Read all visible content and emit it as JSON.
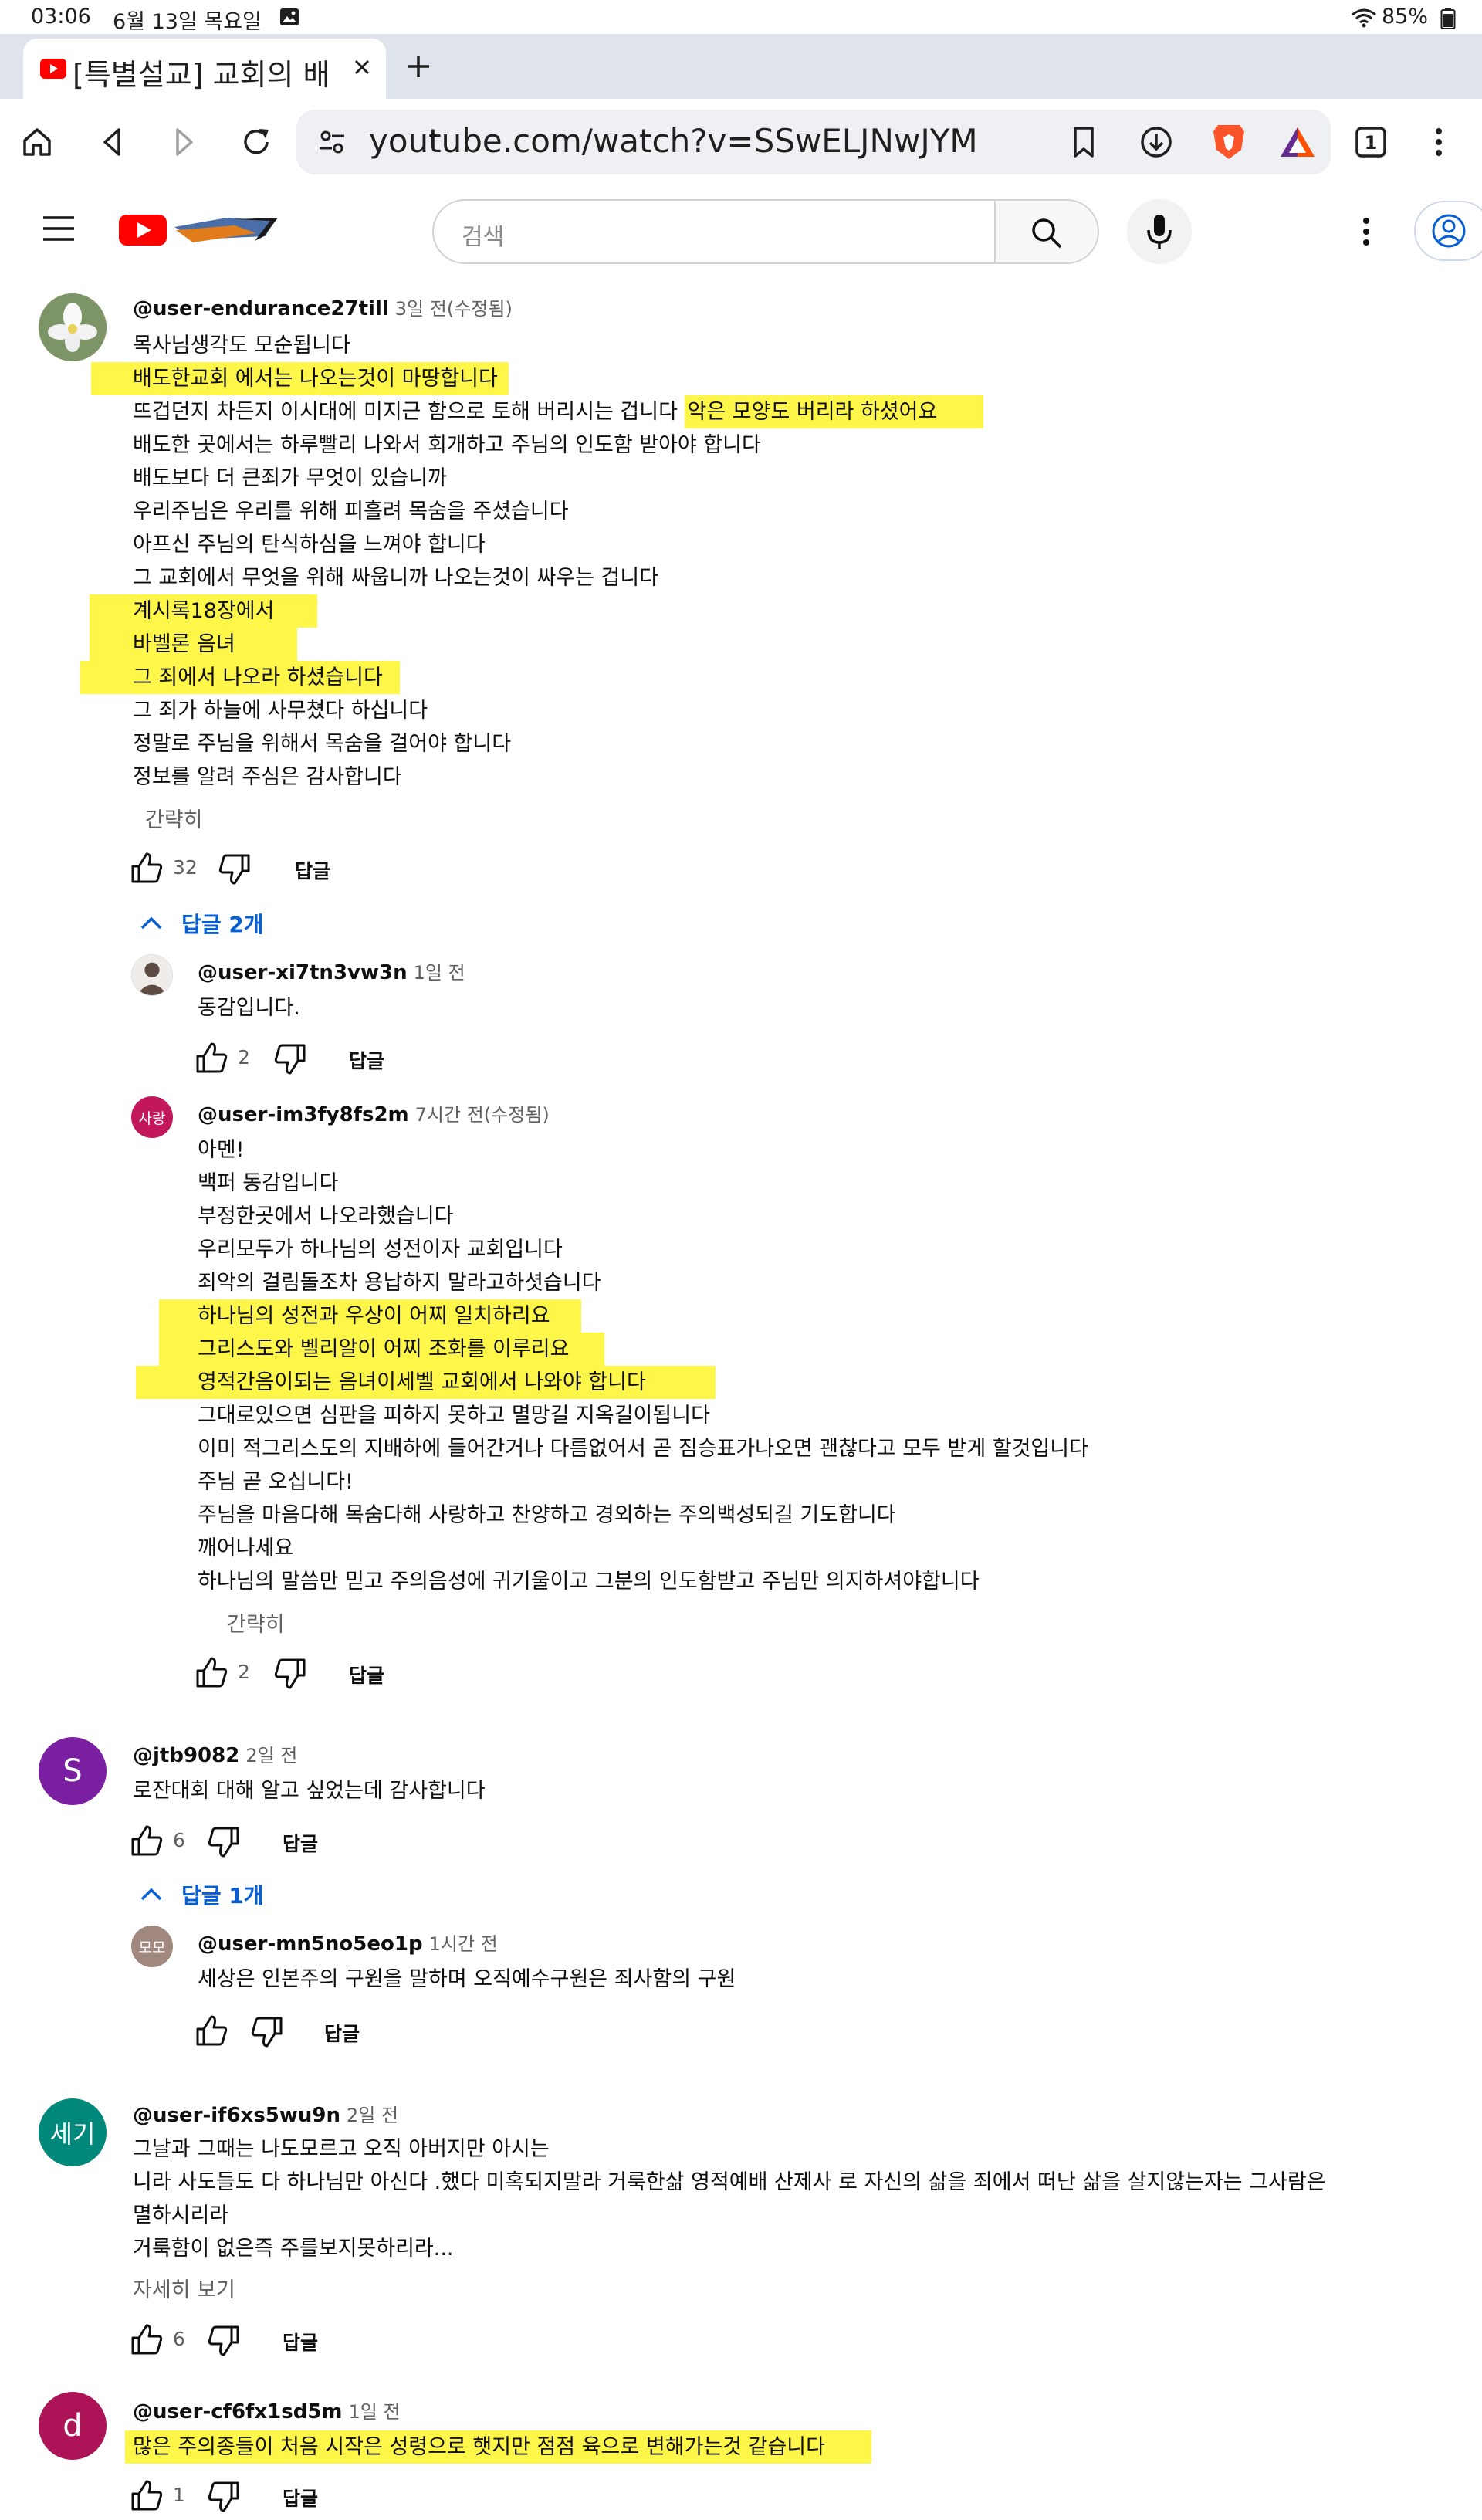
{
  "status_bar": {
    "time": "03:06",
    "date": "6월 13일 목요일",
    "battery": "85%"
  },
  "browser": {
    "tab_title": "[특별설교] 교회의 배",
    "url": "youtube.com/watch?v=SSwELJNwJYM",
    "tab_count": "1"
  },
  "youtube": {
    "search_placeholder": "검색"
  },
  "comments": [
    {
      "avatar_text": "",
      "avatar_color": "#8aa06a",
      "handle": "@user-endurance27till",
      "time": "3일 전(수정됨)",
      "lines": [
        "목사님생각도 모순됩니다",
        "배도한교회 에서는 나오는것이 마땅합니다",
        "뜨겁던지 차든지 이시대에 미지근 함으로 토해 버리시는 겁니다",
        "악은 모양도 버리라 하셨어요",
        "배도한 곳에서는 하루빨리 나와서 회개하고 주님의 인도함 받아야 합니다",
        "배도보다 더 큰죄가 무엇이 있습니까",
        "우리주님은 우리를 위해 피흘려 목숨을 주셨습니다",
        "아프신 주님의 탄식하심을 느껴야 합니다",
        "그 교회에서 무엇을 위해  싸웁니까 나오는것이 싸우는 겁니다",
        "계시록18장에서",
        "바벨론 음녀",
        "그 죄에서 나오라 하셨습니다",
        "그 죄가 하늘에 사무쳤다 하십니다",
        "정말로 주님을 위해서 목숨을 걸어야 합니다",
        "정보를 알려 주심은 감사합니다"
      ],
      "less_label": "간략히",
      "likes": "32",
      "reply_label": "답글",
      "replies_toggle": "답글 2개",
      "replies": [
        {
          "avatar_text": "",
          "avatar_color": "#5d4b44",
          "handle": "@user-xi7tn3vw3n",
          "time": "1일 전",
          "lines": [
            "동감입니다."
          ],
          "likes": "2",
          "reply_label": "답글"
        },
        {
          "avatar_text": "사랑",
          "avatar_color": "#c2185b",
          "handle": "@user-im3fy8fs2m",
          "time": "7시간 전(수정됨)",
          "lines": [
            "아멘!",
            "백퍼 동감입니다",
            "부정한곳에서 나오라했습니다",
            "우리모두가 하나님의 성전이자 교회입니다",
            "죄악의 걸림돌조차  용납하지 말라고하셧습니다",
            "하나님의 성전과 우상이 어찌 일치하리요",
            "그리스도와 벨리알이 어찌 조화를 이루리요",
            "영적간음이되는 음녀이세벨 교회에서 나와야 합니다",
            "그대로있으면 심판을 피하지 못하고 멸망길 지옥길이됩니다",
            "이미 적그리스도의 지배하에 들어간거나 다름없어서 곧 짐승표가나오면 괜찮다고 모두 받게 할것입니다",
            "주님 곧 오십니다!",
            "주님을 마음다해 목숨다해 사랑하고 찬양하고 경외하는 주의백성되길 기도합니다",
            "깨어나세요",
            "하나님의 말씀만 믿고 주의음성에 귀기울이고 그분의 인도함받고 주님만 의지하셔야합니다"
          ],
          "less_label": "간략히",
          "likes": "2",
          "reply_label": "답글"
        }
      ]
    },
    {
      "avatar_text": "S",
      "avatar_color": "#7b1fa2",
      "handle": "@jtb9082",
      "time": "2일 전",
      "lines": [
        "로잔대회 대해 알고 싶었는데  감사합니다"
      ],
      "likes": "6",
      "reply_label": "답글",
      "replies_toggle": "답글 1개",
      "replies": [
        {
          "avatar_text": "모모",
          "avatar_color": "#a1887f",
          "handle": "@user-mn5no5eo1p",
          "time": "1시간 전",
          "lines": [
            "세상은 인본주의 구원을 말하며 오직예수구원은 죄사함의 구원"
          ],
          "likes": "",
          "reply_label": "답글"
        }
      ]
    },
    {
      "avatar_text": "세기",
      "avatar_color": "#00897b",
      "handle": "@user-if6xs5wu9n",
      "time": "2일 전",
      "lines": [
        "그날과 그때는 나도모르고  오직  아버지만    아시는",
        "니라       사도들도   다   하나님만 아신다 .했다     미혹되지말라    거룩한삶  영적예배  산제사    로  자신의 삶을 죄에서   떠난 삶을   살지않는자는   그사람은",
        "멸하시리라",
        "거룩함이 없은즉   주를보지못하리라..."
      ],
      "more_label": "자세히 보기",
      "likes": "6",
      "reply_label": "답글"
    },
    {
      "avatar_text": "d",
      "avatar_color": "#ad1457",
      "handle": "@user-cf6fx1sd5m",
      "time": "1일 전",
      "lines": [
        "많은 주의종들이 처음 시작은 성령으로 햇지만 점점 육으로 변해가는것  같습니다"
      ],
      "likes": "1",
      "reply_label": "답글"
    }
  ]
}
